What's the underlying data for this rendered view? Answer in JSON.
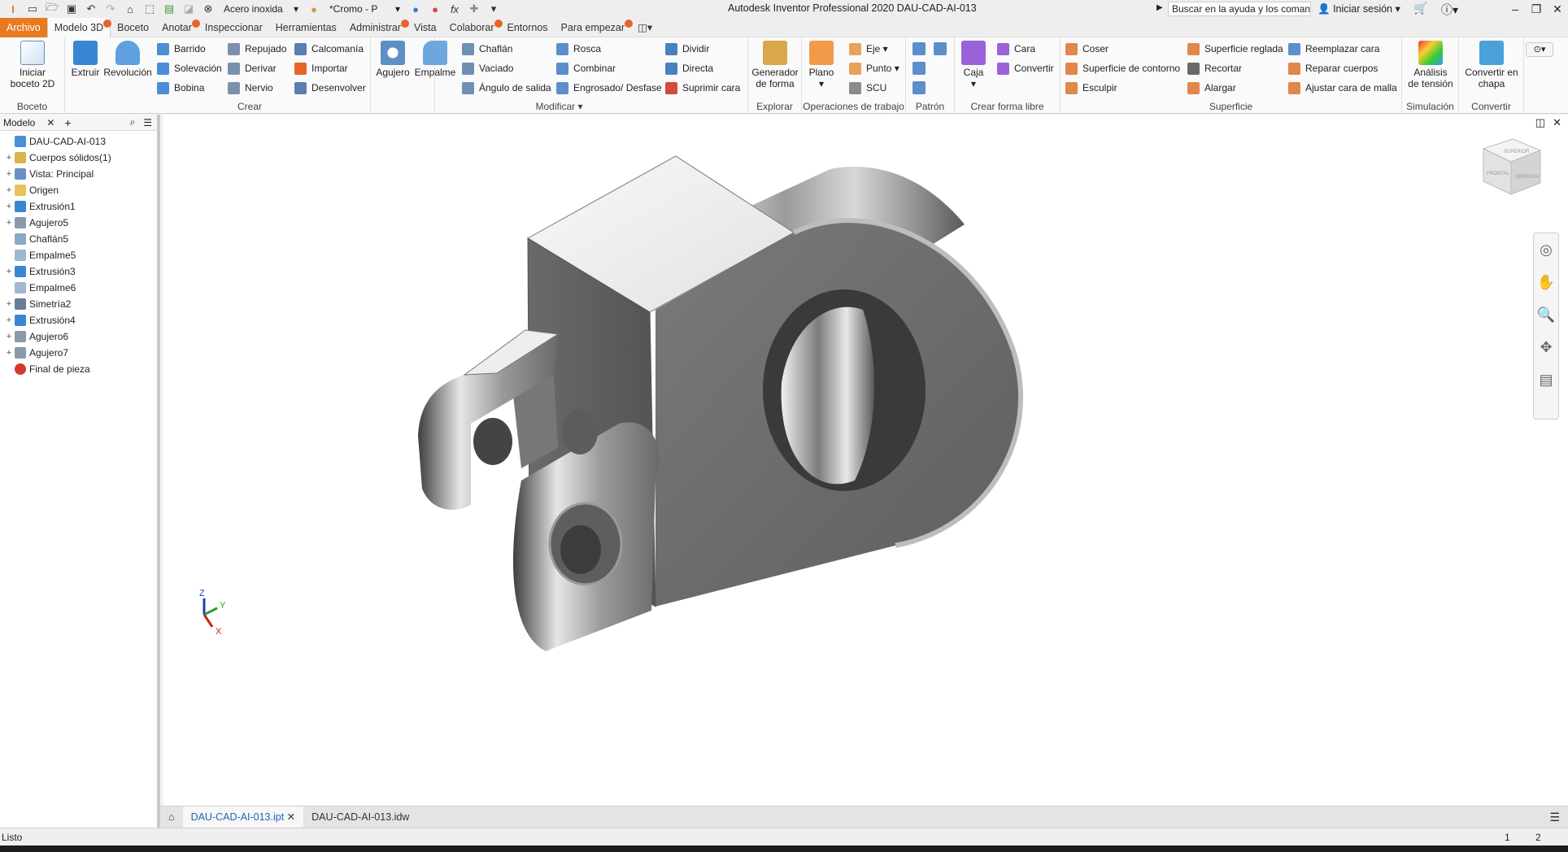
{
  "app": {
    "title": "Autodesk Inventor Professional 2020   DAU-CAD-AI-013",
    "material": "Acero inoxida",
    "appearance": "*Cromo - P",
    "help_search": "Buscar en la ayuda y los comanc",
    "sign_in": "Iniciar sesión"
  },
  "menu": {
    "tabs": [
      "Archivo",
      "Modelo 3D",
      "Boceto",
      "Anotar",
      "Inspeccionar",
      "Herramientas",
      "Administrar",
      "Vista",
      "Colaborar",
      "Entornos",
      "Para empezar"
    ]
  },
  "ribbon": {
    "boceto": {
      "label": "Boceto",
      "start": "Iniciar\nboceto 2D"
    },
    "crear": {
      "label": "Crear",
      "extruir": "Extruir",
      "revolucion": "Revolución",
      "barrido": "Barrido",
      "solevacion": "Solevación",
      "bobina": "Bobina",
      "repujado": "Repujado",
      "derivar": "Derivar",
      "nervio": "Nervio",
      "calcomania": "Calcomanía",
      "importar": "Importar",
      "desenvolver": "Desenvolver"
    },
    "modificar": {
      "label": "Modificar",
      "agujero": "Agujero",
      "empalme": "Empalme",
      "chaflan": "Chaflán",
      "vaciado": "Vaciado",
      "angulo": "Ángulo de salida",
      "rosca": "Rosca",
      "combinar": "Combinar",
      "engrosado": "Engrosado/ Desfase",
      "dividir": "Dividir",
      "directa": "Directa",
      "suprimir": "Suprimir cara"
    },
    "explorar": {
      "label": "Explorar",
      "generador": "Generador\nde forma"
    },
    "operaciones": {
      "label": "Operaciones de trabajo",
      "plano": "Plano",
      "eje": "Eje",
      "punto": "Punto",
      "scu": "SCU"
    },
    "patron": {
      "label": "Patrón"
    },
    "formalibre": {
      "label": "Crear forma libre",
      "caja": "Caja",
      "cara": "Cara",
      "convertir": "Convertir"
    },
    "superficie": {
      "label": "Superficie",
      "coser": "Coser",
      "contorno": "Superficie de contorno",
      "esculpir": "Esculpir",
      "reglada": "Superficie reglada",
      "recortar": "Recortar",
      "alargar": "Alargar",
      "reemplazar": "Reemplazar cara",
      "reparar": "Reparar cuerpos",
      "ajustar": "Ajustar cara de malla"
    },
    "simulacion": {
      "label": "Simulación",
      "analisis": "Análisis\nde tensión"
    },
    "convertir": {
      "label": "Convertir",
      "chapa": "Convertir en\nchapa"
    }
  },
  "browser": {
    "tab": "Modelo",
    "items": [
      {
        "label": "DAU-CAD-AI-013",
        "exp": "",
        "color": "#4a8fd6",
        "indent": 0
      },
      {
        "label": "Cuerpos sólidos(1)",
        "exp": "+",
        "color": "#d9b44a",
        "indent": 1
      },
      {
        "label": "Vista: Principal",
        "exp": "+",
        "color": "#6b8fbf",
        "indent": 1
      },
      {
        "label": "Origen",
        "exp": "+",
        "color": "#e7c45a",
        "indent": 1
      },
      {
        "label": "Extrusión1",
        "exp": "+",
        "color": "#3b86d4",
        "indent": 1
      },
      {
        "label": "Agujero5",
        "exp": "+",
        "color": "#8a9aab",
        "indent": 1
      },
      {
        "label": "Chaflán5",
        "exp": "",
        "color": "#8aa8c8",
        "indent": 1
      },
      {
        "label": "Empalme5",
        "exp": "",
        "color": "#9fb8d2",
        "indent": 1
      },
      {
        "label": "Extrusión3",
        "exp": "+",
        "color": "#3b86d4",
        "indent": 1
      },
      {
        "label": "Empalme6",
        "exp": "",
        "color": "#9fb8d2",
        "indent": 1
      },
      {
        "label": "Simetría2",
        "exp": "+",
        "color": "#6a7d96",
        "indent": 1
      },
      {
        "label": "Extrusión4",
        "exp": "+",
        "color": "#3b86d4",
        "indent": 1
      },
      {
        "label": "Agujero6",
        "exp": "+",
        "color": "#8a9aab",
        "indent": 1
      },
      {
        "label": "Agujero7",
        "exp": "+",
        "color": "#8a9aab",
        "indent": 1
      },
      {
        "label": "Final de pieza",
        "exp": "",
        "color": "#d33a2e",
        "indent": 1
      }
    ]
  },
  "doc_tabs": [
    "DAU-CAD-AI-013.ipt",
    "DAU-CAD-AI-013.idw"
  ],
  "status": {
    "text": "Listo",
    "n1": "1",
    "n2": "2"
  },
  "viewcube": {
    "top": "SUPERIOR",
    "front": "FRONTAL",
    "right": "DERECHA"
  },
  "axes": {
    "x": "X",
    "y": "Y",
    "z": "Z"
  }
}
